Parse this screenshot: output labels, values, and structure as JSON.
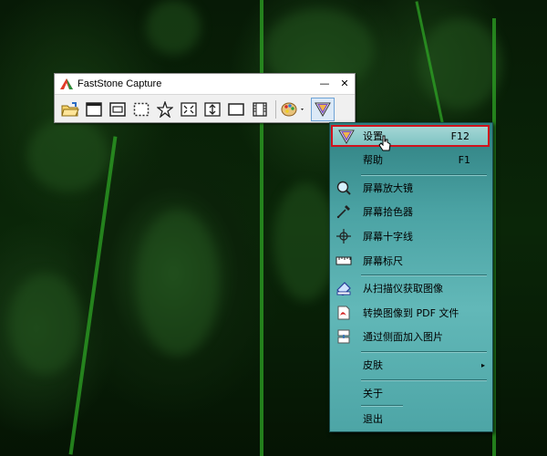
{
  "toolbar": {
    "title": "FastStone Capture",
    "minimize_glyph": "—",
    "close_glyph": "✕",
    "icons": [
      "open-folder-icon",
      "capture-window-icon",
      "capture-object-icon",
      "capture-rect-icon",
      "capture-freehand-icon",
      "capture-fullscreen-icon",
      "capture-scrolling-icon",
      "capture-fixed-region-icon",
      "record-video-icon",
      "palette-icon",
      "settings-menu-icon"
    ]
  },
  "menu": {
    "items": [
      {
        "label": "设置",
        "shortcut": "F12",
        "icon": "settings-icon",
        "highlighted": true
      },
      {
        "label": "帮助",
        "shortcut": "F1",
        "icon": ""
      },
      {
        "label": "屏幕放大镜",
        "shortcut": "",
        "icon": "magnifier-icon"
      },
      {
        "label": "屏幕拾色器",
        "shortcut": "",
        "icon": "color-picker-icon"
      },
      {
        "label": "屏幕十字线",
        "shortcut": "",
        "icon": "crosshair-icon"
      },
      {
        "label": "屏幕标尺",
        "shortcut": "",
        "icon": "ruler-icon"
      },
      {
        "label": "从扫描仪获取图像",
        "shortcut": "",
        "icon": "scanner-icon"
      },
      {
        "label": "转换图像到 PDF 文件",
        "shortcut": "",
        "icon": "pdf-icon"
      },
      {
        "label": "通过侧面加入图片",
        "shortcut": "",
        "icon": "side-join-icon"
      },
      {
        "label": "皮肤",
        "shortcut": "",
        "icon": "",
        "submenu_arrow": "▸"
      },
      {
        "label": "关于",
        "shortcut": "",
        "icon": ""
      },
      {
        "label": "退出",
        "shortcut": "",
        "icon": ""
      }
    ]
  },
  "colors": {
    "menu_highlight_border": "#d0121c",
    "menu_bg": "#4aa2a3",
    "wallpaper": "#0a2608"
  }
}
